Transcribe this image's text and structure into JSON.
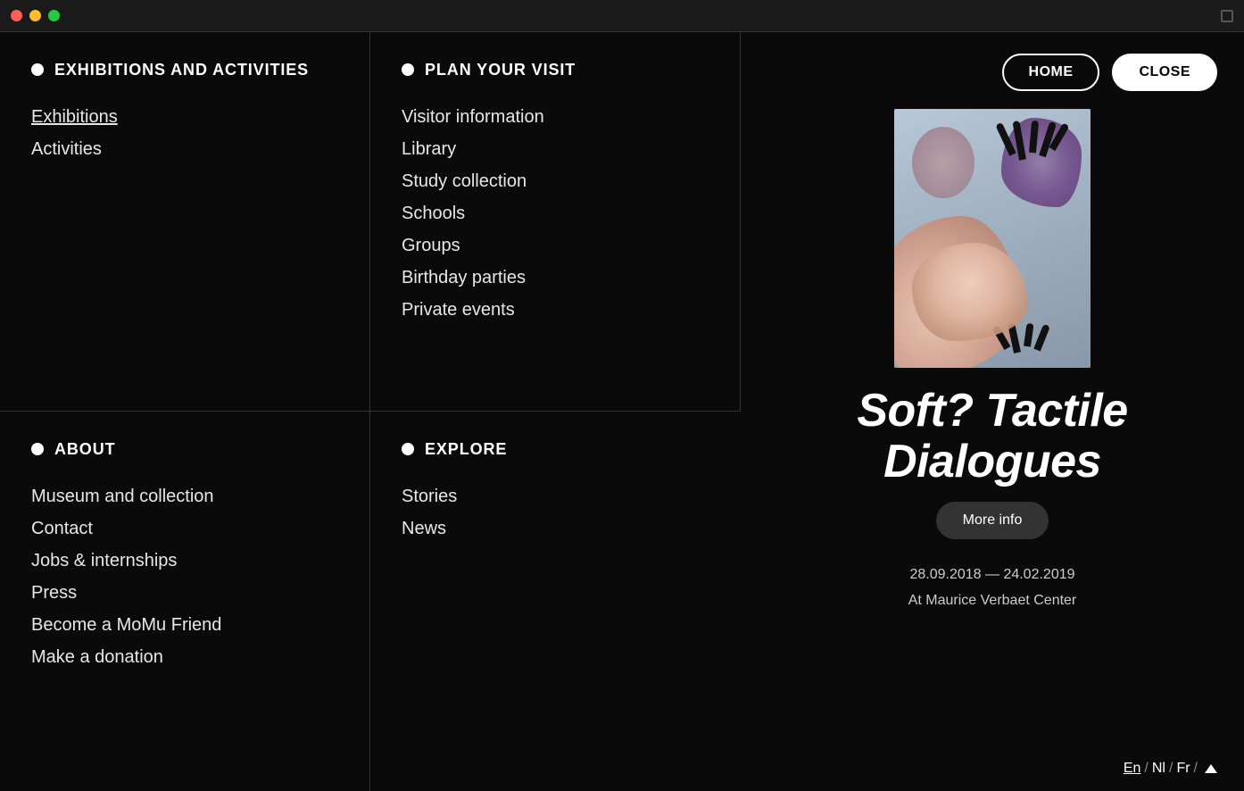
{
  "window": {
    "traffic_lights": [
      "red",
      "yellow",
      "green"
    ]
  },
  "header": {
    "home_label": "HOME",
    "close_label": "CLOSE"
  },
  "nav": {
    "exhibitions_activities": {
      "title": "EXHIBITIONS AND ACTIVITIES",
      "items": [
        {
          "label": "Exhibitions",
          "underline": true
        },
        {
          "label": "Activities",
          "underline": false
        }
      ]
    },
    "plan_your_visit": {
      "title": "PLAN YOUR VISIT",
      "items": [
        {
          "label": "Visitor information"
        },
        {
          "label": "Library"
        },
        {
          "label": "Study collection"
        },
        {
          "label": "Schools"
        },
        {
          "label": "Groups"
        },
        {
          "label": "Birthday parties"
        },
        {
          "label": "Private events"
        }
      ]
    },
    "about": {
      "title": "ABOUT",
      "items": [
        {
          "label": "Museum and collection"
        },
        {
          "label": "Contact"
        },
        {
          "label": "Jobs & internships"
        },
        {
          "label": "Press"
        },
        {
          "label": "Become a MoMu Friend"
        },
        {
          "label": "Make a donation"
        }
      ]
    },
    "explore": {
      "title": "EXPLORE",
      "items": [
        {
          "label": "Stories"
        },
        {
          "label": "News"
        }
      ]
    }
  },
  "feature": {
    "title_line1": "Soft? Tactile",
    "title_line2": "Dialogues",
    "more_info_label": "More info",
    "date_range": "28.09.2018 — 24.02.2019",
    "location": "At Maurice Verbaet Center"
  },
  "language": {
    "options": [
      "En",
      "Nl",
      "Fr"
    ],
    "active": "En",
    "separator": "/"
  }
}
